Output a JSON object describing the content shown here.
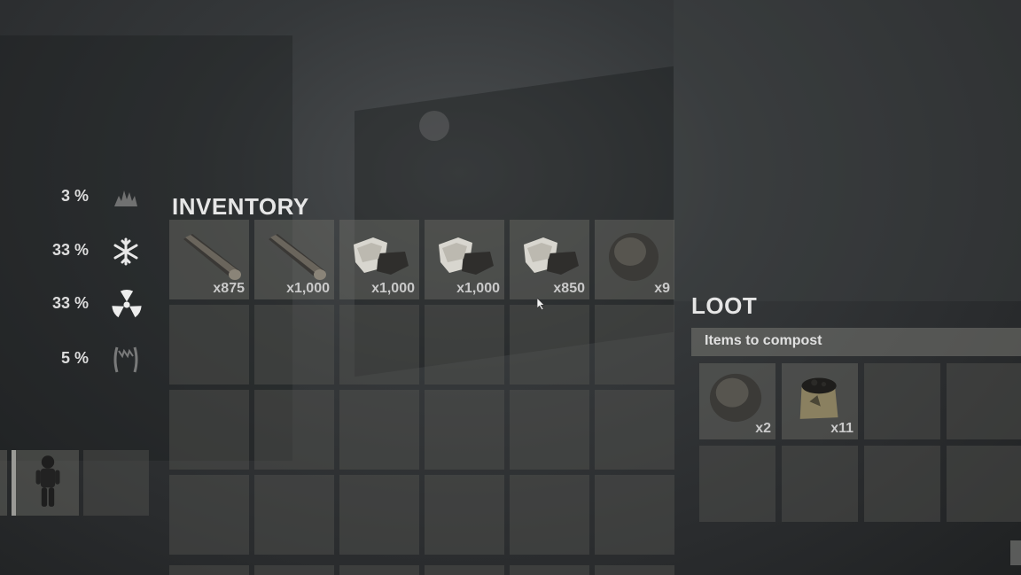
{
  "stats": [
    {
      "value": "3 %",
      "icon": "burning-hunger-icon"
    },
    {
      "value": "33 %",
      "icon": "cold-snowflake-icon"
    },
    {
      "value": "33 %",
      "icon": "radiation-icon"
    },
    {
      "value": "5 %",
      "icon": "bite-teeth-icon"
    }
  ],
  "inventory": {
    "title": "INVENTORY",
    "items": [
      {
        "icon": "wood-log-icon",
        "qty": "x875"
      },
      {
        "icon": "wood-log-icon",
        "qty": "x1,000"
      },
      {
        "icon": "stone-chunk-icon",
        "qty": "x1,000"
      },
      {
        "icon": "stone-chunk-icon",
        "qty": "x1,000"
      },
      {
        "icon": "stone-chunk-icon",
        "qty": "x850"
      },
      {
        "icon": "round-rock-icon",
        "qty": "x9"
      }
    ]
  },
  "loot": {
    "title": "LOOT",
    "header": "Items to compost",
    "items": [
      {
        "icon": "round-rock-icon",
        "qty": "x2"
      },
      {
        "icon": "fertilizer-bag-icon",
        "qty": "x11"
      }
    ]
  },
  "colors": {
    "text": "#e6e6e6",
    "slot": "#6e6e69"
  }
}
